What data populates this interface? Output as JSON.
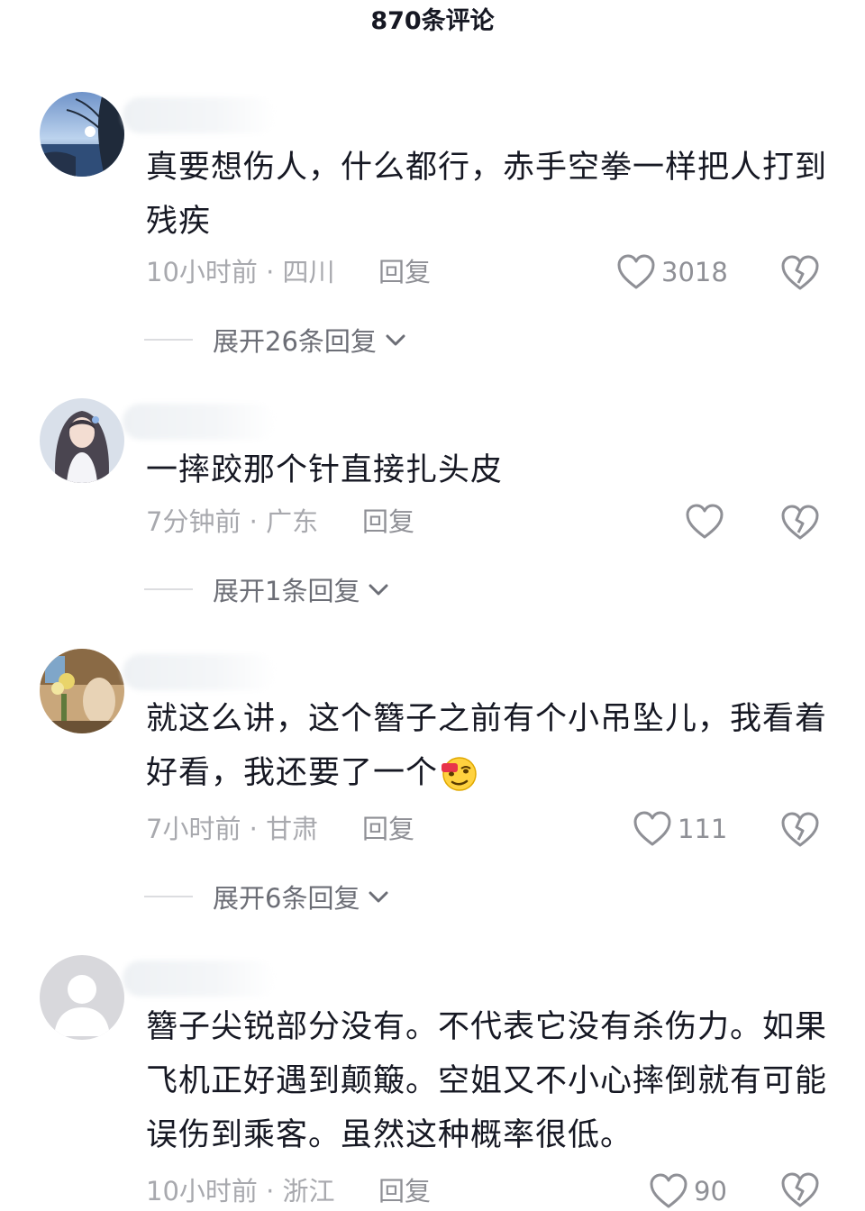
{
  "header": {
    "title": "870条评论"
  },
  "icons": {
    "like": "heart-outline-icon",
    "dislike": "broken-heart-icon",
    "expand": "chevron-down-icon"
  },
  "colors": {
    "text": "#161823",
    "meta": "#a8a9ae",
    "icon": "#8f9096"
  },
  "comments": [
    {
      "avatar": "lake-silhouette-avatar",
      "text": "真要想伤人，什么都行，赤手空拳一样把人打到残疾",
      "time_location": "10小时前 · 四川",
      "reply_label": "回复",
      "likes": "3018",
      "expand_label": "展开26条回复"
    },
    {
      "avatar": "anime-girl-avatar",
      "text": "一摔跤那个针直接扎头皮",
      "time_location": "7分钟前 · 广东",
      "reply_label": "回复",
      "likes": "",
      "expand_label": "展开1条回复"
    },
    {
      "avatar": "flowers-room-avatar",
      "text": "就这么讲，这个簪子之前有个小吊坠儿，我看着好看，我还要了一个",
      "emoji": "sly-smile-emoji",
      "time_location": "7小时前 · 甘肃",
      "reply_label": "回复",
      "likes": "111",
      "expand_label": "展开6条回复"
    },
    {
      "avatar": "default-gray-avatar",
      "text": "簪子尖锐部分没有。不代表它没有杀伤力。如果飞机正好遇到颠簸。空姐又不小心摔倒就有可能误伤到乘客。虽然这种概率很低。",
      "time_location": "10小时前 · 浙江",
      "reply_label": "回复",
      "likes": "90"
    }
  ]
}
